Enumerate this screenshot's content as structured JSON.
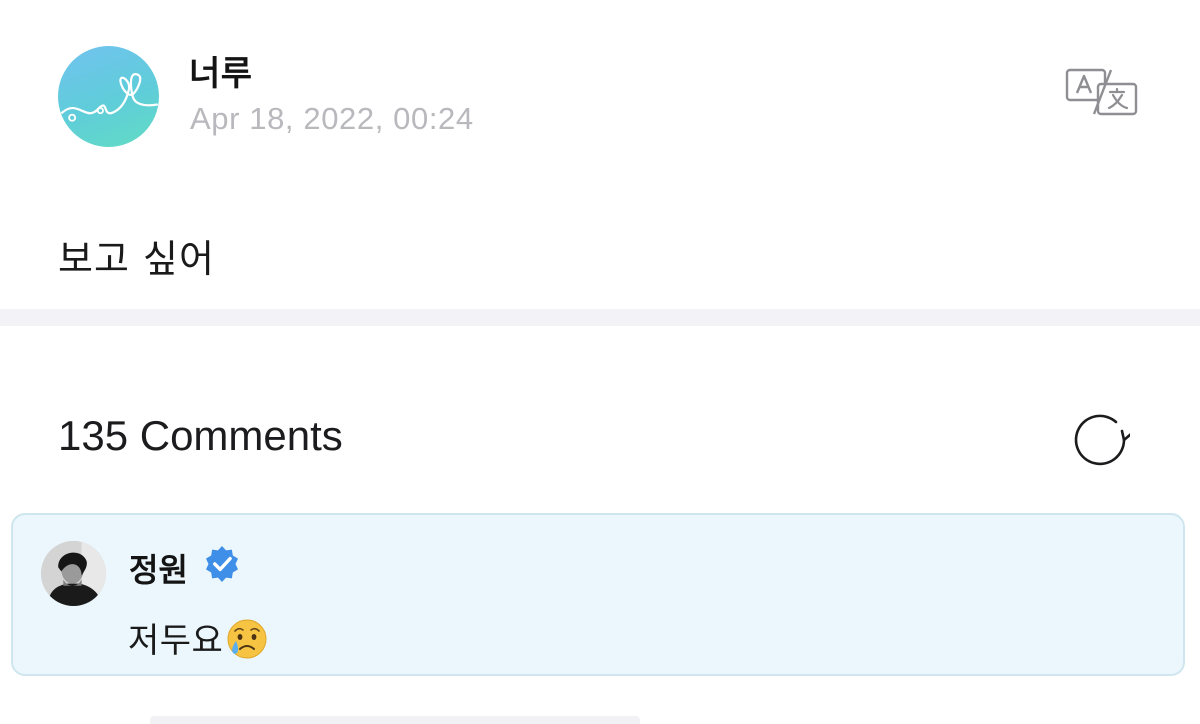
{
  "post": {
    "author_name": "너루",
    "timestamp": "Apr 18, 2022, 00:24",
    "body": "보고 싶어",
    "translate_icon": "translate-icon"
  },
  "comments_section": {
    "count_label": "135 Comments",
    "refresh_icon": "refresh-icon"
  },
  "comments": [
    {
      "author_name": "정원",
      "verified": true,
      "text": "저두요",
      "emoji": "crying-face"
    }
  ],
  "colors": {
    "highlight_background": "#ebf7fc",
    "highlight_border": "#cfe6ef",
    "verified_badge": "#3f8ee8",
    "timestamp": "#b8b8bd",
    "divider": "#f3f2f7"
  }
}
